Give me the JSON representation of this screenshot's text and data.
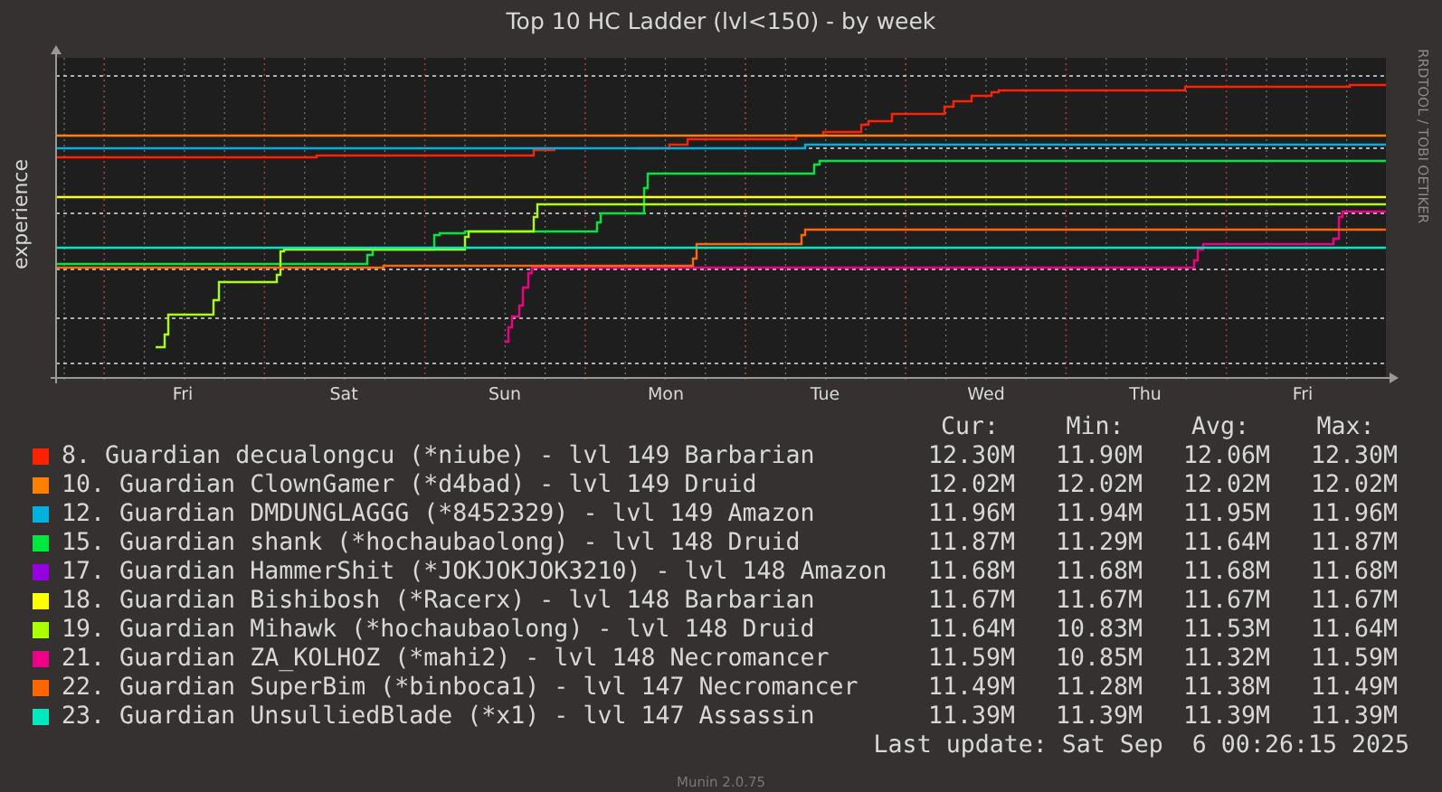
{
  "title": "Top 10 HC Ladder (lvl<150) - by week",
  "y_axis_label": "experience",
  "credit": "RRDTOOL / TOBI OETIKER",
  "x_labels": [
    "Fri",
    "Sat",
    "Sun",
    "Mon",
    "Tue",
    "Wed",
    "Thu",
    "Fri"
  ],
  "legend": {
    "columns": [
      "Cur:",
      "Min:",
      "Avg:",
      "Max:"
    ],
    "rows": [
      {
        "label": "8. Guardian decualongcu (*niube) - lvl 149 Barbarian",
        "color": "#ff2200",
        "cur": "12.30M",
        "min": "11.90M",
        "avg": "12.06M",
        "max": "12.30M"
      },
      {
        "label": "10. Guardian ClownGamer (*d4bad) - lvl 149 Druid",
        "color": "#ff7f00",
        "cur": "12.02M",
        "min": "12.02M",
        "avg": "12.02M",
        "max": "12.02M"
      },
      {
        "label": "12. Guardian DMDUNGLAGGG (*8452329) - lvl 149 Amazon",
        "color": "#00b0dd",
        "cur": "11.96M",
        "min": "11.94M",
        "avg": "11.95M",
        "max": "11.96M"
      },
      {
        "label": "15. Guardian shank (*hochaubaolong) - lvl 148 Druid",
        "color": "#00e840",
        "cur": "11.87M",
        "min": "11.29M",
        "avg": "11.64M",
        "max": "11.87M"
      },
      {
        "label": "17. Guardian HammerShit (*JOKJOKJOK3210) - lvl 148 Amazon",
        "color": "#9400e0",
        "cur": "11.68M",
        "min": "11.68M",
        "avg": "11.68M",
        "max": "11.68M"
      },
      {
        "label": "18. Guardian Bishibosh (*Racerx) - lvl 148 Barbarian",
        "color": "#ffff00",
        "cur": "11.67M",
        "min": "11.67M",
        "avg": "11.67M",
        "max": "11.67M"
      },
      {
        "label": "19. Guardian Mihawk (*hochaubaolong) - lvl 148 Druid",
        "color": "#aaff00",
        "cur": "11.64M",
        "min": "10.83M",
        "avg": "11.53M",
        "max": "11.64M"
      },
      {
        "label": "21. Guardian ZA_KOLHOZ (*mahi2) - lvl 148 Necromancer",
        "color": "#ee0088",
        "cur": "11.59M",
        "min": "10.85M",
        "avg": "11.32M",
        "max": "11.59M"
      },
      {
        "label": "22. Guardian SuperBim (*binboca1) - lvl 147 Necromancer",
        "color": "#ff6600",
        "cur": "11.49M",
        "min": "11.28M",
        "avg": "11.38M",
        "max": "11.49M"
      },
      {
        "label": "23. Guardian UnsulliedBlade (*x1) - lvl 147 Assassin",
        "color": "#00e8c0",
        "cur": "11.39M",
        "min": "11.39M",
        "avg": "11.39M",
        "max": "11.39M"
      }
    ]
  },
  "last_update": "Last update: Sat Sep  6 00:26:15 2025",
  "footer": "Munin 2.0.75"
}
